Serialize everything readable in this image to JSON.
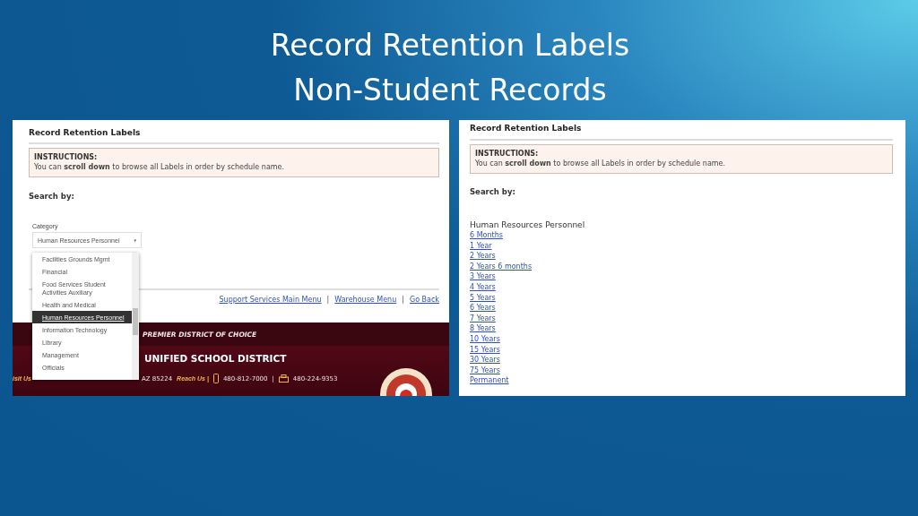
{
  "slide": {
    "title_lines": [
      "Record Retention Labels",
      "Non-Student Records"
    ]
  },
  "left_screen": {
    "heading": "Record Retention Labels",
    "instructions": {
      "label": "INSTRUCTIONS:",
      "text": "You can **scroll down** to browse all Labels in order by schedule name."
    },
    "search_label": "Search by:",
    "category": {
      "label": "Category",
      "value": "Human Resources Personnel",
      "caret": "▾",
      "options": [
        {
          "label": "Facilities Grounds Mgmt",
          "selected": false
        },
        {
          "label": "Financial",
          "selected": false
        },
        {
          "label": "Food Services Student Activities Auxiliary",
          "selected": false
        },
        {
          "label": "Health and Medical",
          "selected": false
        },
        {
          "label": "Human Resources Personnel",
          "selected": true
        },
        {
          "label": "Information Technology",
          "selected": false
        },
        {
          "label": "Library",
          "selected": false
        },
        {
          "label": "Management",
          "selected": false
        },
        {
          "label": "Officials",
          "selected": false
        }
      ]
    },
    "links": [
      "Support Services Main Menu",
      "Warehouse Menu",
      "Go Back"
    ],
    "link_separator": "|",
    "footer": {
      "tagline": "PREMIER DISTRICT OF CHOICE",
      "district": "UNIFIED SCHOOL DISTRICT",
      "contact": [
        {
          "kind": "label",
          "text": "isit Us"
        },
        {
          "kind": "address",
          "text": "AZ 85224"
        },
        {
          "kind": "label",
          "text": "Reach Us |"
        },
        {
          "kind": "phone",
          "text": "480-812-7000"
        },
        {
          "kind": "separator",
          "text": "|"
        },
        {
          "kind": "fax",
          "text": "480-224-9353"
        }
      ]
    }
  },
  "right_screen": {
    "heading": "Record Retention Labels",
    "instructions": {
      "label": "INSTRUCTIONS:",
      "text": "You can **scroll down** to browse all Labels in order by schedule name."
    },
    "search_label": "Search by:",
    "group_heading": "Human Resources Personnel",
    "links": [
      "6 Months",
      "1 Year",
      "2 Years",
      "2 Years 6 months",
      "3 Years",
      "4 Years",
      "5 Years",
      "6 Years",
      "7 Years",
      "8 Years",
      "10 Years",
      "15 Years",
      "30 Years",
      "75 Years",
      "Permanent"
    ]
  }
}
